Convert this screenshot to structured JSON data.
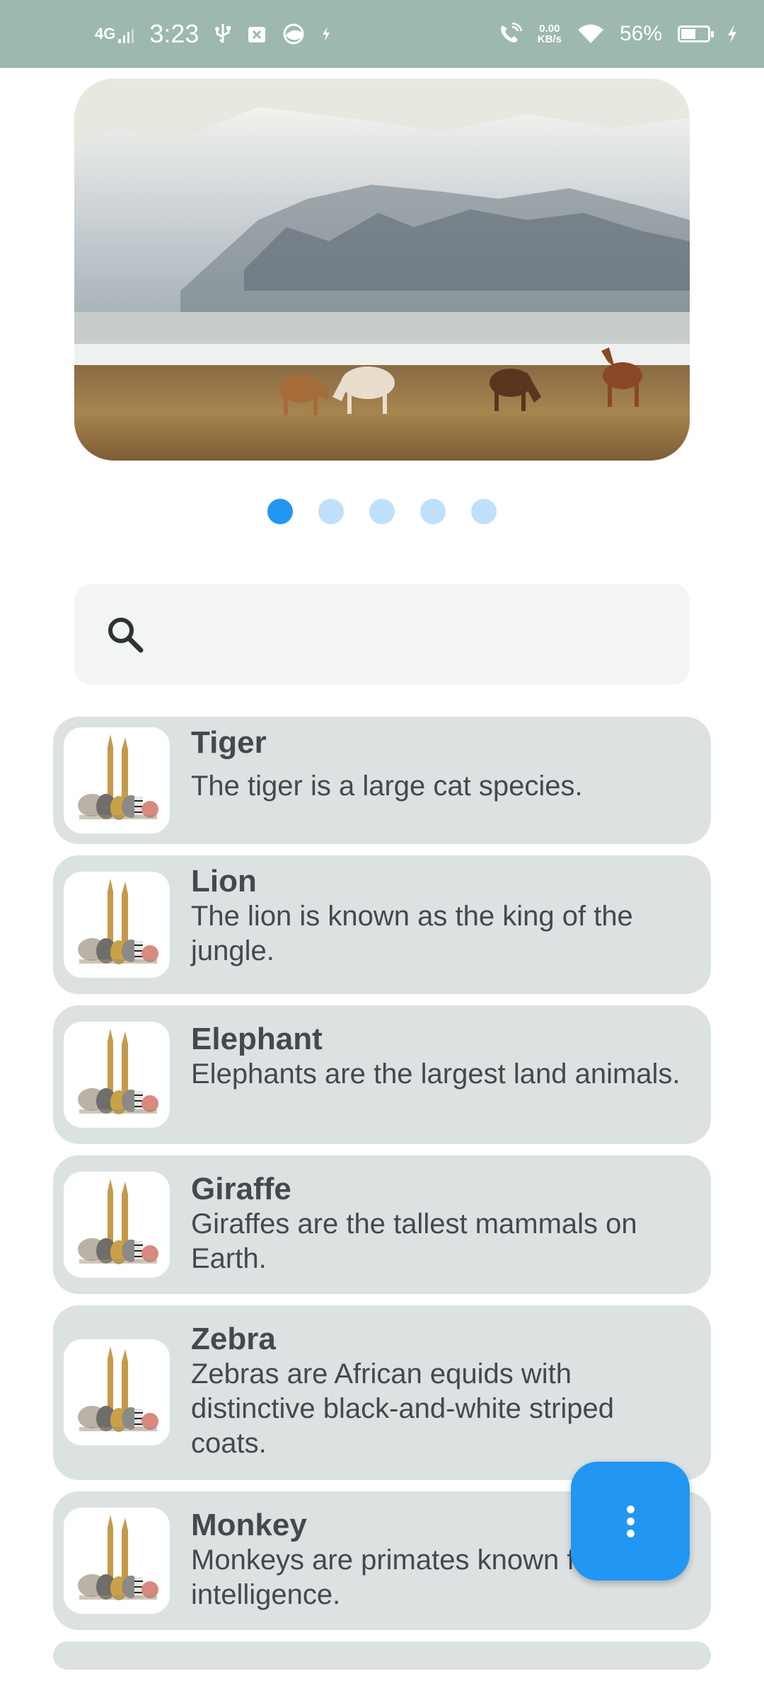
{
  "status_bar": {
    "network": "4G",
    "time": "3:23",
    "speed_value": "0.00",
    "speed_unit": "KB/s",
    "battery_percent": "56%",
    "battery_level": 0.56
  },
  "carousel": {
    "page_count": 5,
    "active_index": 0
  },
  "search": {
    "value": "",
    "placeholder": ""
  },
  "animals": [
    {
      "name": "Tiger",
      "description": "The tiger is a large cat species."
    },
    {
      "name": "Lion",
      "description": "The lion is known as the king of the jungle."
    },
    {
      "name": "Elephant",
      "description": "Elephants are the largest land animals."
    },
    {
      "name": "Giraffe",
      "description": "Giraffes are the tallest mammals on Earth."
    },
    {
      "name": "Zebra",
      "description": "Zebras are African equids with distinctive black-and-white striped coats."
    },
    {
      "name": "Monkey",
      "description": "Monkeys are primates known for their intelligence."
    }
  ],
  "colors": {
    "status_bar": "#9db8b0",
    "card": "#dce2e1",
    "accent": "#2196f3",
    "dot_inactive": "#bfe0fb",
    "search_bg": "#f3f5f5"
  },
  "icons": {
    "search": "search-icon",
    "fab": "more-vert-icon"
  }
}
